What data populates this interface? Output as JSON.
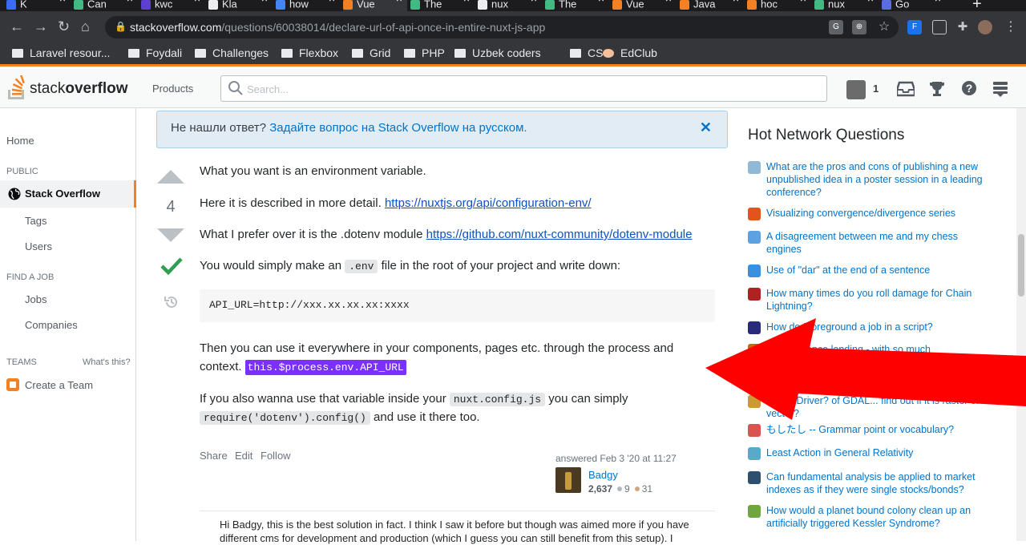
{
  "browser": {
    "tabs": [
      {
        "label": "K",
        "color": "#3b6bf5"
      },
      {
        "label": "Can",
        "color": "#42b883"
      },
      {
        "label": "kwc",
        "color": "#5d3fd3"
      },
      {
        "label": "Kla",
        "color": "#eeeeee"
      },
      {
        "label": "how",
        "color": "#4285f4"
      },
      {
        "label": "Vue",
        "color": "#f48024"
      },
      {
        "label": "The",
        "color": "#42b883"
      },
      {
        "label": "nux",
        "color": "#eeeeee"
      },
      {
        "label": "The",
        "color": "#42b883"
      },
      {
        "label": "Vue",
        "color": "#f48024"
      },
      {
        "label": "Java",
        "color": "#f48024"
      },
      {
        "label": "hoc",
        "color": "#f48024"
      },
      {
        "label": "nux",
        "color": "#42b883"
      },
      {
        "label": "Go",
        "color": "#5b6ee1"
      }
    ],
    "url_host": "stackoverflow.com",
    "url_path": "/questions/60038014/declare-url-of-api-once-in-entire-nuxt-js-app",
    "bookmarks": [
      "Laravel resour...",
      "Foydali",
      "Challenges",
      "Flexbox",
      "Grid",
      "PHP",
      "Uzbek coders",
      "CSS",
      "EdClub"
    ]
  },
  "header": {
    "logo_light": "stack",
    "logo_bold": "overflow",
    "products": "Products",
    "search_placeholder": "Search...",
    "inbox_count": "1"
  },
  "sidebar": {
    "home": "Home",
    "public": "PUBLIC",
    "stack_overflow": "Stack Overflow",
    "tags": "Tags",
    "users": "Users",
    "find_a_job": "FIND A JOB",
    "jobs": "Jobs",
    "companies": "Companies",
    "teams": "TEAMS",
    "whats_this": "What's this?",
    "create_team": "Create a Team"
  },
  "notice": {
    "text": "Не нашли ответ? ",
    "link": "Задайте вопрос на Stack Overflow на русском."
  },
  "answer": {
    "score": "4",
    "p1": "What you want is an environment variable.",
    "p2_text": "Here it is described in more detail. ",
    "p2_link": "https://nuxtjs.org/api/configuration-env/",
    "p3_text": "What I prefer over it is the .dotenv module ",
    "p3_link": "https://github.com/nuxt-community/dotenv-module",
    "p4_a": "You would simply make an ",
    "p4_code": ".env",
    "p4_b": " file in the root of your project and write down:",
    "code_block": "API_URL=http://xxx.xx.xx.xx:xxxx",
    "p5_line1": "Then you can use it everywhere in your components, pages etc. through the process and",
    "p5_line2": "context. ",
    "p5_highlight": "this.$process.env.API_URL",
    "p6_a": "If you also wanna use that variable inside your ",
    "p6_code1": "nuxt.config.js",
    "p6_b": " you can simply",
    "p6_code2": "require('dotenv').config()",
    "p6_c": " and use it there too.",
    "share": "Share",
    "edit": "Edit",
    "follow": "Follow",
    "answered": "answered Feb 3 '20 at 11:27",
    "user": "Badgy",
    "rep": "2,637",
    "silver": "9",
    "bronze": "31",
    "comment": "Hi Badgy, this is the best solution in fact. I think I saw it before but though was aimed more if you have different cms for development and production (which I guess you can still benefit from this setup). I"
  },
  "hnq": {
    "title": "Hot Network Questions",
    "items": [
      {
        "text": "What are the pros and cons of publishing a new unpublished idea in a poster session in a leading conference?",
        "color": "#8fb9d6"
      },
      {
        "text": "Visualizing convergence/divergence series",
        "color": "#e2541b"
      },
      {
        "text": "A disagreement between me and my chess engines",
        "color": "#5fa1e0"
      },
      {
        "text": "Use of \"dar\" at the end of a sentence",
        "color": "#3b8fe0"
      },
      {
        "text": "How many times do you roll damage for Chain Lightning?",
        "color": "#b02222"
      },
      {
        "text": "How do I foreground a job in a script?",
        "color": "#2a2a7a"
      },
      {
        "text": "Perseverance landing - with so much",
        "color": "#cc6600"
      },
      {
        "text": "",
        "color": "#dddddd"
      },
      {
        "text": "GDAL/Driver? of GDAL... find out if it is raster or vector?",
        "color": "#cc9933"
      },
      {
        "text": "もしたし -- Grammar point or vocabulary?",
        "color": "#d9534f"
      },
      {
        "text": "Least Action in General Relativity",
        "color": "#5aa9c9"
      },
      {
        "text": "Can fundamental analysis be applied to market indexes as if they were single stocks/bonds?",
        "color": "#2f4f6f"
      },
      {
        "text": "How would a planet bound colony clean up an artificially triggered Kessler Syndrome?",
        "color": "#6fa642"
      }
    ]
  },
  "colors": {
    "accent": "#f48024",
    "link": "#0074cc",
    "highlight": "#7a30ff",
    "arrow": "#ff0000"
  }
}
